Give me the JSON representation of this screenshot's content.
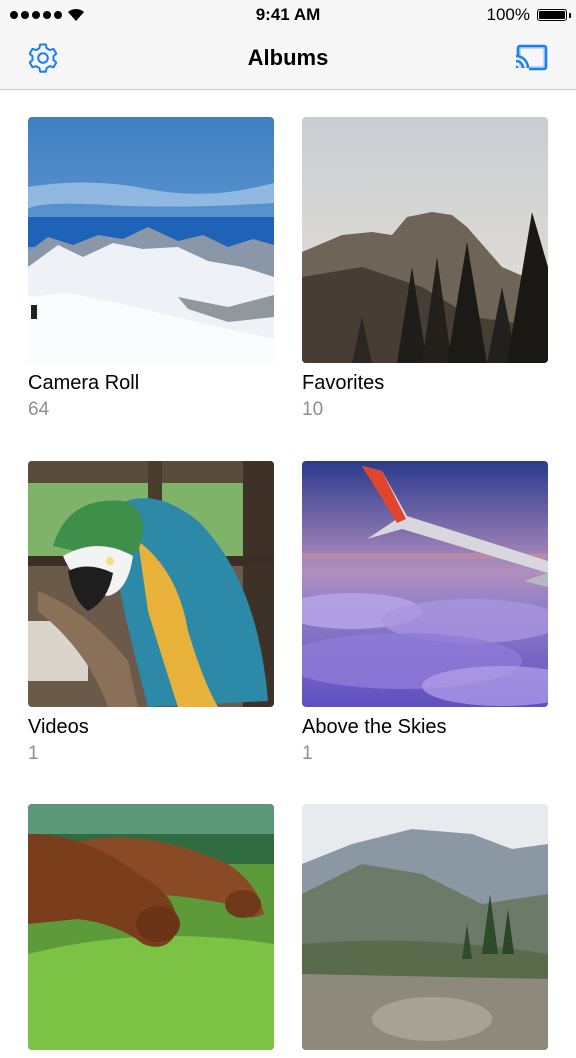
{
  "status_bar": {
    "time": "9:41 AM",
    "battery": "100%"
  },
  "nav": {
    "title": "Albums",
    "left_icon": "gear-icon",
    "right_icon": "cast-icon",
    "accent_color": "#1a7ef5"
  },
  "albums": [
    {
      "title": "Camera Roll",
      "count": "64"
    },
    {
      "title": "Favorites",
      "count": "10"
    },
    {
      "title": "Videos",
      "count": "1"
    },
    {
      "title": "Above the Skies",
      "count": "1"
    },
    {
      "title": "",
      "count": ""
    },
    {
      "title": "",
      "count": ""
    }
  ]
}
